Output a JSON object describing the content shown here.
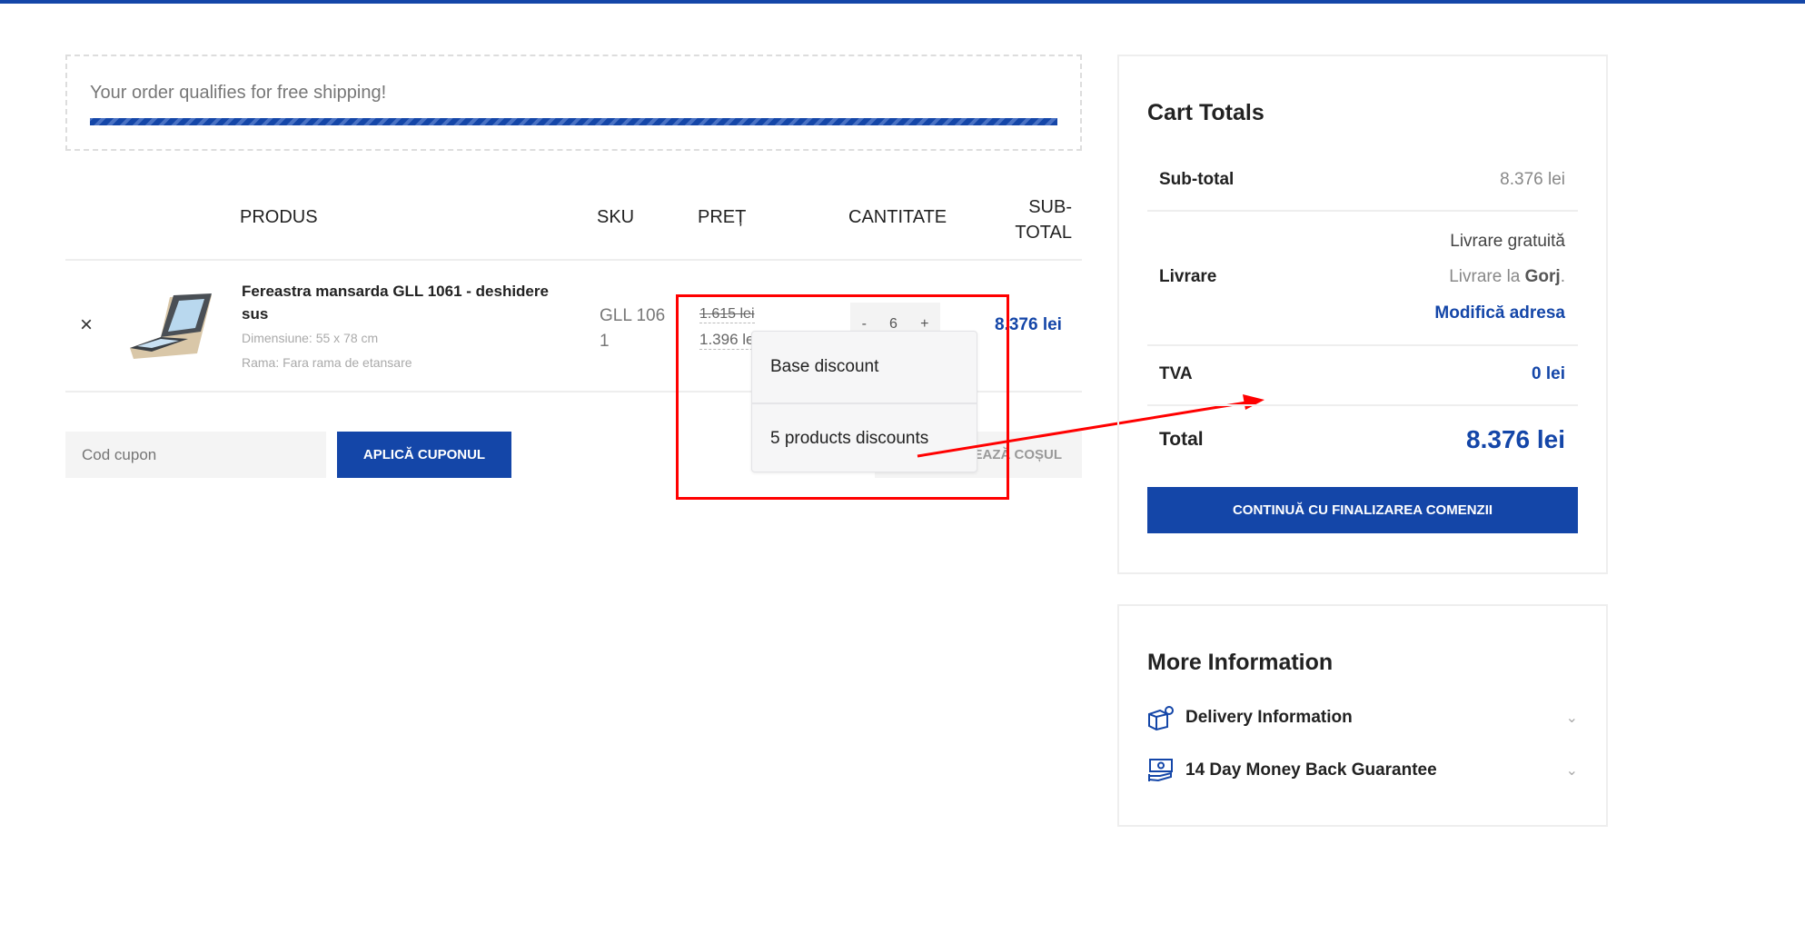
{
  "shipping": {
    "message": "Your order qualifies for free shipping!",
    "progress_percent": 100
  },
  "table": {
    "headers": {
      "product": "PRODUS",
      "sku": "SKU",
      "price": "PREȚ",
      "quantity": "CANTITATE",
      "subtotal_1": "SUB-",
      "subtotal_2": "TOTAL"
    },
    "rows": [
      {
        "remove": "×",
        "title_1": "Fereastra mansarda GLL 1061 - deshidere",
        "title_2": "sus",
        "dimension": "Dimensiune: 55 x 78 cm",
        "frame": "Rama: Fara rama de etansare",
        "sku_1": "GLL 106",
        "sku_2": "1",
        "old_price": "1.615 lei",
        "new_price": "1.396 lei",
        "qty_minus": "-",
        "qty": "6",
        "qty_plus": "+",
        "subtotal": "8.376 lei"
      }
    ]
  },
  "coupon": {
    "placeholder": "Cod cupon",
    "apply": "APLICĂ CUPONUL",
    "update": "ACTUALIZEAZĂ COȘUL"
  },
  "tooltip": {
    "items": [
      "Base discount",
      "5 products discounts"
    ]
  },
  "annotation": {
    "color": "#ff0000"
  },
  "totals": {
    "title": "Cart Totals",
    "subtotal_label": "Sub-total",
    "subtotal_value": "8.376 lei",
    "shipping_label": "Livrare",
    "shipping_method": "Livrare gratuită",
    "shipping_to": "Livrare la ",
    "shipping_region": "Gorj",
    "shipping_dot": ".",
    "change_address": "Modifică adresa",
    "tax_label": "TVA",
    "tax_value": "0 lei",
    "total_label": "Total",
    "total_value": "8.376 lei",
    "checkout": "CONTINUĂ CU FINALIZAREA COMENZII"
  },
  "more_info": {
    "title": "More Information",
    "items": [
      {
        "label": "Delivery Information",
        "icon": "delivery-box-icon"
      },
      {
        "label": "14 Day Money Back Guarantee",
        "icon": "money-hand-icon"
      }
    ]
  },
  "colors": {
    "accent": "#1446a8",
    "annotation": "#ff0000"
  }
}
